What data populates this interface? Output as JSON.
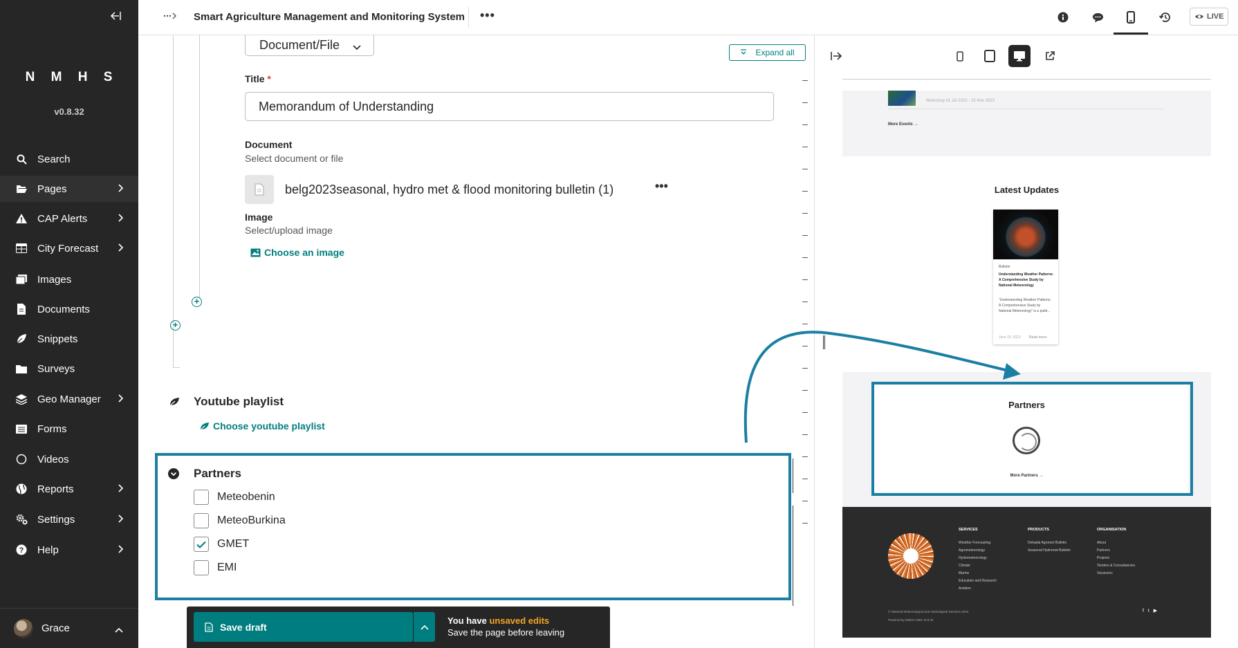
{
  "sidebar": {
    "brand": "N M H S",
    "version": "v0.8.32",
    "items": [
      {
        "label": "Search",
        "icon": "search-icon",
        "has_children": false
      },
      {
        "label": "Pages",
        "icon": "folder-open-icon",
        "has_children": true
      },
      {
        "label": "CAP Alerts",
        "icon": "warning-icon",
        "has_children": true
      },
      {
        "label": "City Forecast",
        "icon": "table-icon",
        "has_children": true
      },
      {
        "label": "Images",
        "icon": "images-icon",
        "has_children": false
      },
      {
        "label": "Documents",
        "icon": "document-icon",
        "has_children": false
      },
      {
        "label": "Snippets",
        "icon": "leaf-icon",
        "has_children": false
      },
      {
        "label": "Surveys",
        "icon": "folder-icon",
        "has_children": false
      },
      {
        "label": "Geo Manager",
        "icon": "layers-icon",
        "has_children": true
      },
      {
        "label": "Forms",
        "icon": "list-icon",
        "has_children": false
      },
      {
        "label": "Videos",
        "icon": "circle-icon",
        "has_children": false
      },
      {
        "label": "Reports",
        "icon": "globe-icon",
        "has_children": true
      },
      {
        "label": "Settings",
        "icon": "cogs-icon",
        "has_children": true
      },
      {
        "label": "Help",
        "icon": "help-icon",
        "has_children": true
      }
    ],
    "user": {
      "name": "Grace"
    }
  },
  "header": {
    "page_title": "Smart Agriculture Management and Monitoring System",
    "live_label": "LIVE"
  },
  "editor": {
    "document_type_select": "Document/File",
    "expand_all": "Expand all",
    "title_label": "Title",
    "title_required": "*",
    "title_value": "Memorandum of Understanding",
    "document_label": "Document",
    "document_help": "Select document or file",
    "document_name": "belg2023seasonal, hydro met & flood monitoring bulletin (1)",
    "document_more": "•••",
    "image_label": "Image",
    "image_help": "Select/upload image",
    "choose_image": "Choose an image",
    "youtube": {
      "title": "Youtube playlist",
      "choose_label": "Choose youtube playlist"
    },
    "partners": {
      "title": "Partners",
      "options": [
        {
          "label": "Meteobenin",
          "checked": false
        },
        {
          "label": "MeteoBurkina",
          "checked": false
        },
        {
          "label": "GMET",
          "checked": true
        },
        {
          "label": "EMI",
          "checked": false
        }
      ]
    }
  },
  "savebar": {
    "save_label": "Save draft",
    "msg_prefix": "You have ",
    "msg_highlight": "unsaved edits",
    "msg_sub": "Save the page before leaving"
  },
  "preview": {
    "events": {
      "meta": "Workshop    01 Jul 2023 - 15 Nov 2023",
      "more": "More Events →"
    },
    "updates_title": "Latest Updates",
    "card": {
      "category": "Bulletin",
      "title": "Understanding Weather Patterns: A Comprehensive Study by National Meteorology",
      "desc": "\"Understanding Weather Patterns: A Comprehensive Study by National Meteorology\" is a publi...",
      "date": "June 19, 2023",
      "read_more": "Read more"
    },
    "partners_title": "Partners",
    "partners_more": "More Partners →",
    "footer": {
      "services_h": "SERVICES",
      "services": [
        "Weather Forecasting",
        "Agrometeorology",
        "Hydrometeorology",
        "Climate",
        "Marine",
        "Education and Research",
        "Aviation"
      ],
      "products_h": "PRODUCTS",
      "products": [
        "Dekadal Agromet Bulletin",
        "Seasonal Hydromet Bulletin"
      ],
      "org_h": "ORGANISATION",
      "org": [
        "About",
        "Partners",
        "Projects",
        "Tenders & Consultancies",
        "Vacancies"
      ],
      "copyright": "© National Meteorological and Hydrological Services 2023",
      "powered": "Powered by NMHS CMS v0.8.32",
      "social": "f t ▶"
    }
  },
  "colors": {
    "accent": "#007d7e",
    "highlight": "#1a7fa3",
    "sidebar_bg": "#262626",
    "warning": "#f5a623"
  }
}
